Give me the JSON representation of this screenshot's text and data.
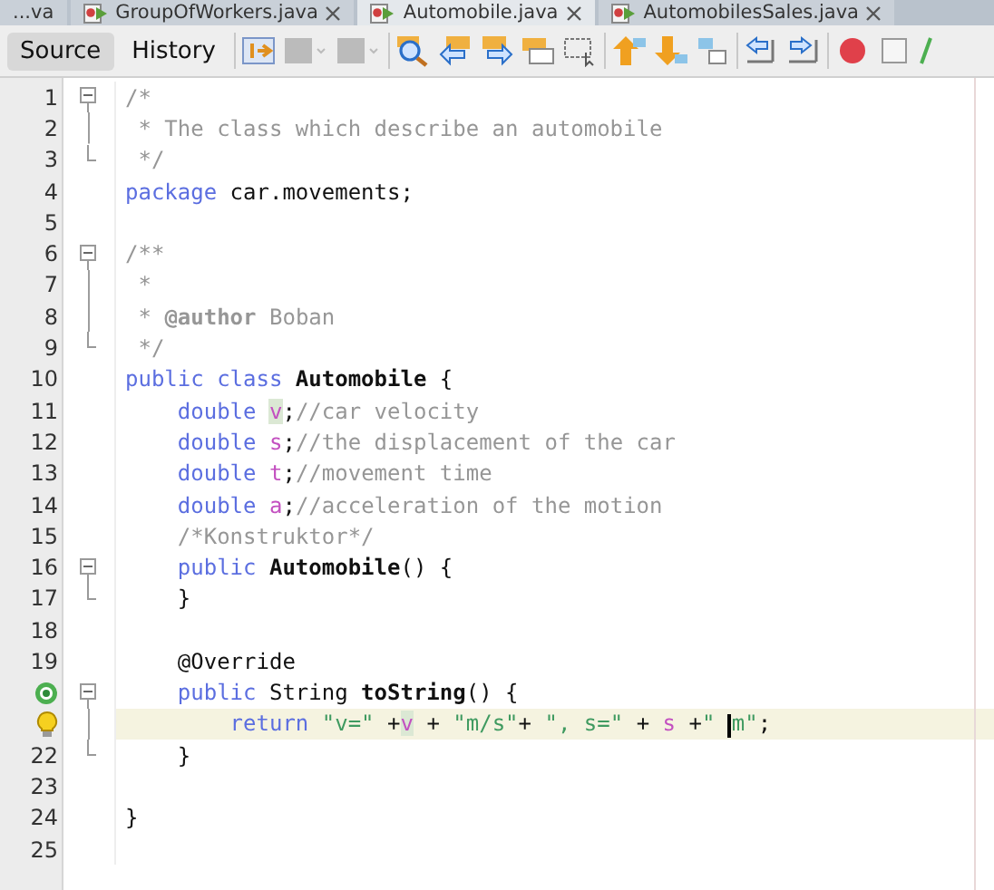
{
  "file_tabs": [
    {
      "label": "...va",
      "selected": false,
      "icon": false
    },
    {
      "label": "GroupOfWorkers.java",
      "selected": false,
      "icon": true
    },
    {
      "label": "Automobile.java",
      "selected": true,
      "icon": true
    },
    {
      "label": "AutomobilesSales.java",
      "selected": false,
      "icon": true
    }
  ],
  "view_tabs": [
    {
      "label": "Source",
      "selected": true
    },
    {
      "label": "History",
      "selected": false
    }
  ],
  "lines": [
    {
      "number": "1",
      "fold_start": true,
      "fold_inside": false,
      "fold_end": false,
      "override_mark": false,
      "hint_mark": false,
      "current": false,
      "tokens": [
        {
          "kind": "comment",
          "text": "/*"
        }
      ]
    },
    {
      "number": "2",
      "fold_start": false,
      "fold_inside": true,
      "fold_end": false,
      "override_mark": false,
      "hint_mark": false,
      "current": false,
      "tokens": [
        {
          "kind": "comment",
          "text": " * The class which describe an automobile"
        }
      ]
    },
    {
      "number": "3",
      "fold_start": false,
      "fold_inside": false,
      "fold_end": true,
      "override_mark": false,
      "hint_mark": false,
      "current": false,
      "tokens": [
        {
          "kind": "comment",
          "text": " */"
        }
      ]
    },
    {
      "number": "4",
      "fold_start": false,
      "fold_inside": false,
      "fold_end": false,
      "override_mark": false,
      "hint_mark": false,
      "current": false,
      "tokens": [
        {
          "kind": "keyword",
          "text": "package"
        },
        {
          "kind": "plain",
          "text": " car.movements;"
        }
      ]
    },
    {
      "number": "5",
      "fold_start": false,
      "fold_inside": false,
      "fold_end": false,
      "override_mark": false,
      "hint_mark": false,
      "current": false
    },
    {
      "number": "6",
      "fold_start": true,
      "fold_inside": false,
      "fold_end": false,
      "override_mark": false,
      "hint_mark": false,
      "current": false,
      "tokens": [
        {
          "kind": "comment",
          "text": "/**"
        }
      ]
    },
    {
      "number": "7",
      "fold_start": false,
      "fold_inside": true,
      "fold_end": false,
      "override_mark": false,
      "hint_mark": false,
      "current": false,
      "tokens": [
        {
          "kind": "comment",
          "text": " *"
        }
      ]
    },
    {
      "number": "8",
      "fold_start": false,
      "fold_inside": true,
      "fold_end": false,
      "override_mark": false,
      "hint_mark": false,
      "current": false,
      "tokens": [
        {
          "kind": "comment",
          "text": " * "
        },
        {
          "kind": "doctag",
          "text": "@author"
        },
        {
          "kind": "comment",
          "text": " Boban"
        }
      ]
    },
    {
      "number": "9",
      "fold_start": false,
      "fold_inside": false,
      "fold_end": true,
      "override_mark": false,
      "hint_mark": false,
      "current": false,
      "tokens": [
        {
          "kind": "comment",
          "text": " */"
        }
      ]
    },
    {
      "number": "10",
      "fold_start": false,
      "fold_inside": false,
      "fold_end": false,
      "override_mark": false,
      "hint_mark": false,
      "current": false,
      "tokens": [
        {
          "kind": "keyword",
          "text": "public class "
        },
        {
          "kind": "bold",
          "text": "Automobile"
        },
        {
          "kind": "plain",
          "text": " {"
        }
      ]
    },
    {
      "number": "11",
      "fold_start": false,
      "fold_inside": false,
      "fold_end": false,
      "override_mark": false,
      "hint_mark": false,
      "current": false,
      "tokens": [
        {
          "kind": "keyword",
          "text": "    double "
        },
        {
          "kind": "field-marked",
          "text": "v"
        },
        {
          "kind": "plain",
          "text": ";"
        },
        {
          "kind": "comment",
          "text": "//car velocity"
        }
      ]
    },
    {
      "number": "12",
      "fold_start": false,
      "fold_inside": false,
      "fold_end": false,
      "override_mark": false,
      "hint_mark": false,
      "current": false,
      "tokens": [
        {
          "kind": "keyword",
          "text": "    double "
        },
        {
          "kind": "field",
          "text": "s"
        },
        {
          "kind": "plain",
          "text": ";"
        },
        {
          "kind": "comment",
          "text": "//the displacement of the car"
        }
      ]
    },
    {
      "number": "13",
      "fold_start": false,
      "fold_inside": false,
      "fold_end": false,
      "override_mark": false,
      "hint_mark": false,
      "current": false,
      "tokens": [
        {
          "kind": "keyword",
          "text": "    double "
        },
        {
          "kind": "field",
          "text": "t"
        },
        {
          "kind": "plain",
          "text": ";"
        },
        {
          "kind": "comment",
          "text": "//movement time"
        }
      ]
    },
    {
      "number": "14",
      "fold_start": false,
      "fold_inside": false,
      "fold_end": false,
      "override_mark": false,
      "hint_mark": false,
      "current": false,
      "tokens": [
        {
          "kind": "keyword",
          "text": "    double "
        },
        {
          "kind": "field",
          "text": "a"
        },
        {
          "kind": "plain",
          "text": ";"
        },
        {
          "kind": "comment",
          "text": "//acceleration of the motion"
        }
      ]
    },
    {
      "number": "15",
      "fold_start": false,
      "fold_inside": false,
      "fold_end": false,
      "override_mark": false,
      "hint_mark": false,
      "current": false,
      "tokens": [
        {
          "kind": "comment",
          "text": "    /*Konstruktor*/"
        }
      ]
    },
    {
      "number": "16",
      "fold_start": true,
      "fold_inside": false,
      "fold_end": false,
      "override_mark": false,
      "hint_mark": false,
      "current": false,
      "tokens": [
        {
          "kind": "keyword",
          "text": "    public "
        },
        {
          "kind": "bold",
          "text": "Automobile"
        },
        {
          "kind": "plain",
          "text": "() {"
        }
      ]
    },
    {
      "number": "17",
      "fold_start": false,
      "fold_inside": false,
      "fold_end": true,
      "override_mark": false,
      "hint_mark": false,
      "current": false,
      "tokens": [
        {
          "kind": "plain",
          "text": "    }"
        }
      ]
    },
    {
      "number": "18",
      "fold_start": false,
      "fold_inside": false,
      "fold_end": false,
      "override_mark": false,
      "hint_mark": false,
      "current": false
    },
    {
      "number": "19",
      "fold_start": false,
      "fold_inside": false,
      "fold_end": false,
      "override_mark": false,
      "hint_mark": false,
      "current": false,
      "tokens": [
        {
          "kind": "plain",
          "text": "    @Override"
        }
      ]
    },
    {
      "fold_start": true,
      "fold_inside": false,
      "fold_end": false,
      "override_mark": true,
      "hint_mark": false,
      "current": false,
      "tokens": [
        {
          "kind": "keyword",
          "text": "    public"
        },
        {
          "kind": "plain",
          "text": " String "
        },
        {
          "kind": "bold",
          "text": "toString"
        },
        {
          "kind": "plain",
          "text": "() {"
        }
      ]
    },
    {
      "fold_start": false,
      "fold_inside": true,
      "fold_end": false,
      "override_mark": false,
      "hint_mark": true,
      "current": true,
      "tokens": [
        {
          "kind": "keyword",
          "text": "        return "
        },
        {
          "kind": "string",
          "text": "\"v=\""
        },
        {
          "kind": "plain",
          "text": " +"
        },
        {
          "kind": "field-marked",
          "text": "v"
        },
        {
          "kind": "plain",
          "text": " + "
        },
        {
          "kind": "string",
          "text": "\"m/s\""
        },
        {
          "kind": "plain",
          "text": "+ "
        },
        {
          "kind": "string",
          "text": "\", s=\""
        },
        {
          "kind": "plain",
          "text": " + "
        },
        {
          "kind": "field",
          "text": "s"
        },
        {
          "kind": "plain",
          "text": " +"
        },
        {
          "kind": "string",
          "text": "\" "
        },
        {
          "kind": "caret"
        },
        {
          "kind": "string",
          "text": "m\""
        },
        {
          "kind": "plain",
          "text": ";"
        }
      ]
    },
    {
      "number": "22",
      "fold_start": false,
      "fold_inside": false,
      "fold_end": true,
      "override_mark": false,
      "hint_mark": false,
      "current": false,
      "tokens": [
        {
          "kind": "plain",
          "text": "    }"
        }
      ]
    },
    {
      "number": "23",
      "fold_start": false,
      "fold_inside": false,
      "fold_end": false,
      "override_mark": false,
      "hint_mark": false,
      "current": false
    },
    {
      "number": "24",
      "fold_start": false,
      "fold_inside": false,
      "fold_end": false,
      "override_mark": false,
      "hint_mark": false,
      "current": false,
      "tokens": [
        {
          "kind": "plain",
          "text": "}"
        }
      ]
    },
    {
      "number": "25",
      "fold_start": false,
      "fold_inside": false,
      "fold_end": false,
      "override_mark": false,
      "hint_mark": false,
      "current": false
    }
  ]
}
